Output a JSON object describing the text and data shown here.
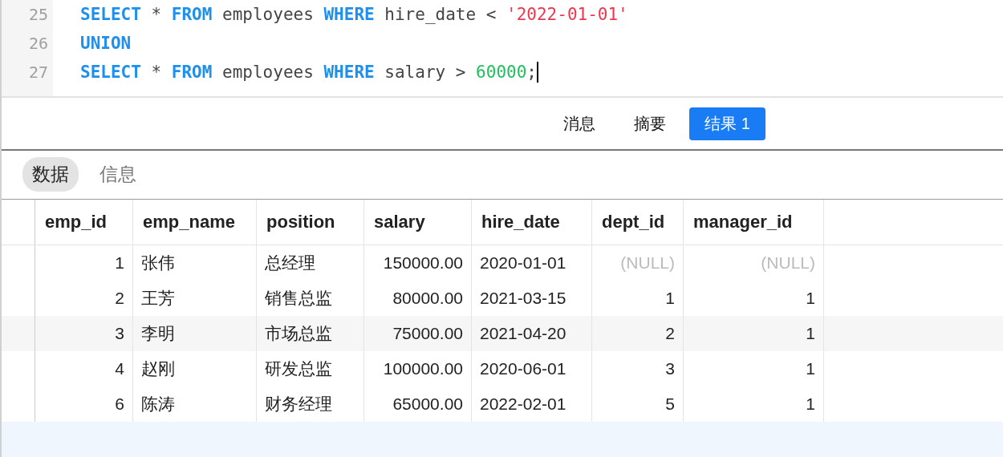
{
  "editor": {
    "lines": [
      {
        "number": "25",
        "tokens": [
          {
            "kind": "keyword",
            "text": "SELECT"
          },
          {
            "kind": "plain",
            "text": " * "
          },
          {
            "kind": "keyword",
            "text": "FROM"
          },
          {
            "kind": "plain",
            "text": " employees "
          },
          {
            "kind": "keyword",
            "text": "WHERE"
          },
          {
            "kind": "plain",
            "text": " hire_date < "
          },
          {
            "kind": "string",
            "text": "'2022-01-01'"
          }
        ]
      },
      {
        "number": "26",
        "tokens": [
          {
            "kind": "keyword",
            "text": "UNION"
          }
        ]
      },
      {
        "number": "27",
        "cursor": true,
        "tokens": [
          {
            "kind": "keyword",
            "text": "SELECT"
          },
          {
            "kind": "plain",
            "text": " * "
          },
          {
            "kind": "keyword",
            "text": "FROM"
          },
          {
            "kind": "plain",
            "text": " employees "
          },
          {
            "kind": "keyword",
            "text": "WHERE"
          },
          {
            "kind": "plain",
            "text": " salary > "
          },
          {
            "kind": "number",
            "text": "60000"
          },
          {
            "kind": "plain",
            "text": ";"
          }
        ]
      }
    ]
  },
  "result_tabs": [
    {
      "label": "消息",
      "selected": false
    },
    {
      "label": "摘要",
      "selected": false
    },
    {
      "label": "结果 1",
      "selected": true
    }
  ],
  "view_tabs": [
    {
      "label": "数据",
      "selected": true
    },
    {
      "label": "信息",
      "selected": false
    }
  ],
  "table": {
    "columns": [
      {
        "label": "emp_id",
        "kind": "number"
      },
      {
        "label": "emp_name",
        "kind": "text"
      },
      {
        "label": "position",
        "kind": "text"
      },
      {
        "label": "salary",
        "kind": "number"
      },
      {
        "label": "hire_date",
        "kind": "text"
      },
      {
        "label": "dept_id",
        "kind": "number"
      },
      {
        "label": "manager_id",
        "kind": "number"
      }
    ],
    "rows": [
      {
        "cells": [
          "1",
          "张伟",
          "总经理",
          "150000.00",
          "2020-01-01",
          {
            "text": "(NULL)",
            "kind": "null"
          },
          {
            "text": "(NULL)",
            "kind": "null"
          }
        ]
      },
      {
        "cells": [
          "2",
          "王芳",
          "销售总监",
          "80000.00",
          "2021-03-15",
          "1",
          "1"
        ]
      },
      {
        "cells": [
          "3",
          "李明",
          "市场总监",
          "75000.00",
          "2021-04-20",
          "2",
          "1"
        ]
      },
      {
        "cells": [
          "4",
          "赵刚",
          "研发总监",
          "100000.00",
          "2020-06-01",
          "3",
          "1"
        ]
      },
      {
        "cells": [
          "6",
          "陈涛",
          "财务经理",
          "65000.00",
          "2022-02-01",
          "5",
          "1"
        ]
      }
    ]
  }
}
